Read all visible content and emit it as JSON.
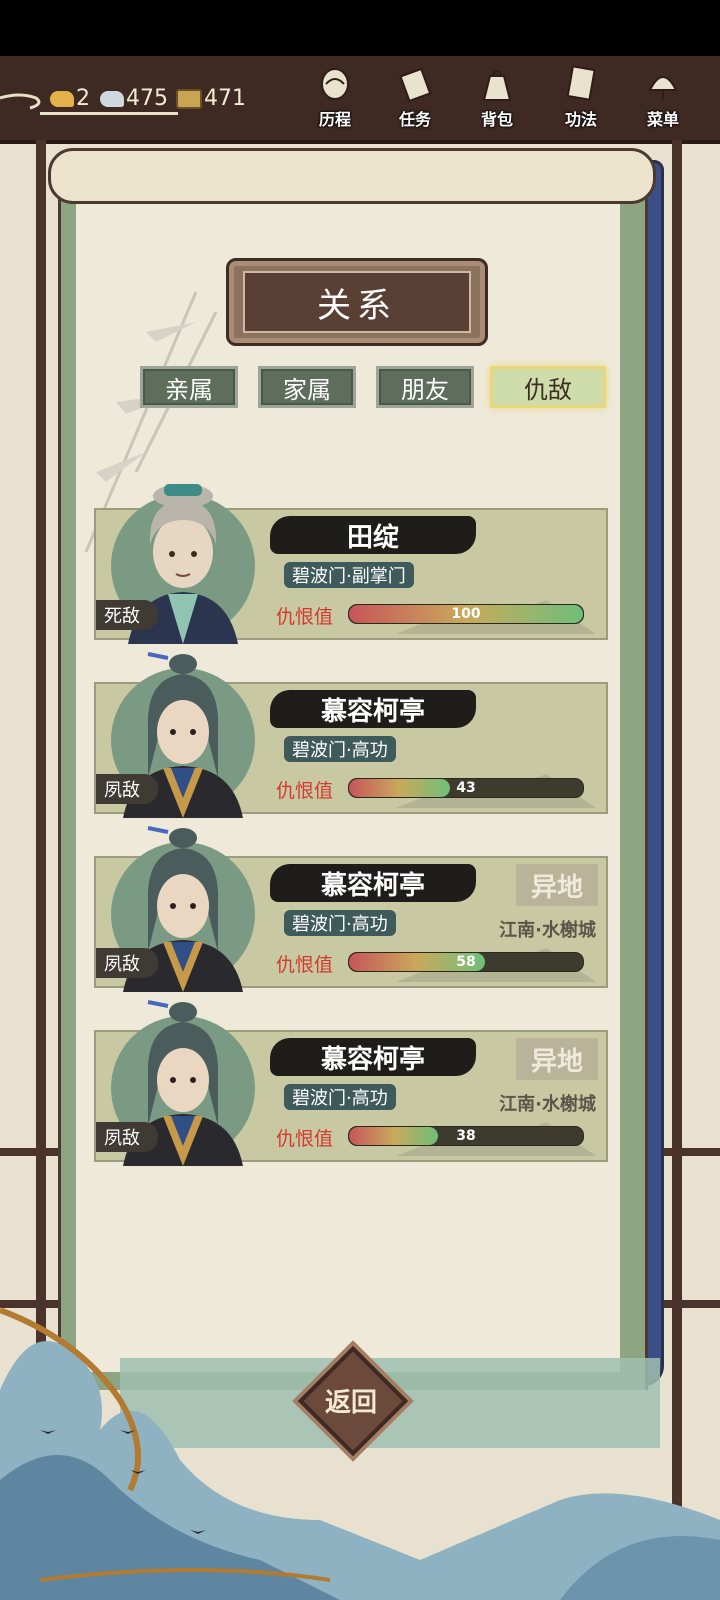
{
  "resources": {
    "ingot": "2",
    "silver": "475",
    "coin": "471"
  },
  "menu": [
    {
      "label": "历程",
      "icon": "scroll-hand-icon"
    },
    {
      "label": "任务",
      "icon": "task-scroll-icon"
    },
    {
      "label": "背包",
      "icon": "bag-icon"
    },
    {
      "label": "功法",
      "icon": "book-icon"
    },
    {
      "label": "菜单",
      "icon": "fan-icon"
    }
  ],
  "title": "关系",
  "tabs": [
    {
      "label": "亲属",
      "active": false
    },
    {
      "label": "家属",
      "active": false
    },
    {
      "label": "朋友",
      "active": false
    },
    {
      "label": "仇敌",
      "active": true
    }
  ],
  "hate_label": "仇恨值",
  "entries": [
    {
      "name": "田绽",
      "sect": "碧波门·副掌门",
      "relation": "死敌",
      "hate": 100,
      "location_badge": "",
      "location": ""
    },
    {
      "name": "慕容柯亭",
      "sect": "碧波门·高功",
      "relation": "夙敌",
      "hate": 43,
      "location_badge": "",
      "location": ""
    },
    {
      "name": "慕容柯亭",
      "sect": "碧波门·高功",
      "relation": "夙敌",
      "hate": 58,
      "location_badge": "异地",
      "location": "江南·水榭城"
    },
    {
      "name": "慕容柯亭",
      "sect": "碧波门·高功",
      "relation": "夙敌",
      "hate": 38,
      "location_badge": "异地",
      "location": "江南·水榭城"
    }
  ],
  "back_label": "返回",
  "colors": {
    "topbar": "#3f2a23",
    "hate_text": "#d23a2f",
    "active_tab": "#cfdcab",
    "card": "#c8c9a3"
  }
}
